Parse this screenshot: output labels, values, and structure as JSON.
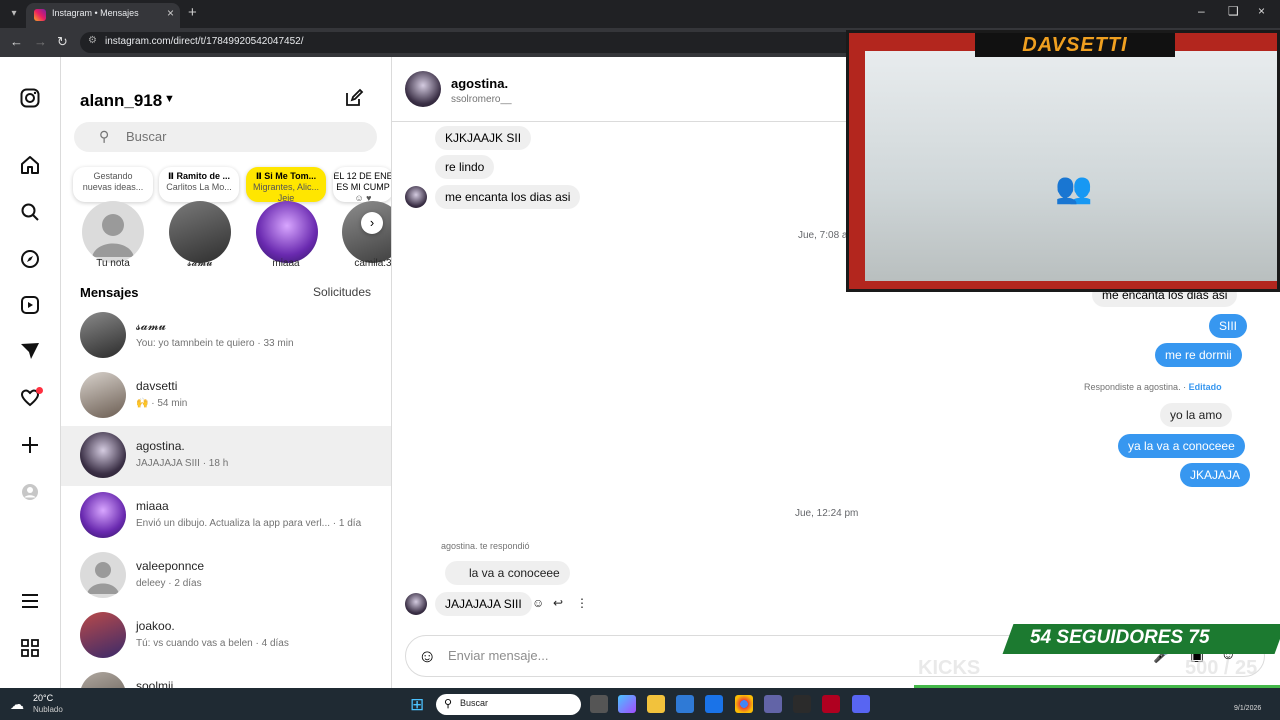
{
  "browser": {
    "tab_title": "Instagram • Mensajes",
    "url": "instagram.com/direct/t/17849920542047452/"
  },
  "rail": {
    "icons": [
      "instagram-logo-icon",
      "home-icon",
      "search-icon",
      "explore-icon",
      "reels-icon",
      "messages-icon",
      "notifications-icon",
      "create-icon",
      "profile-icon",
      "menu-icon",
      "apps-icon"
    ]
  },
  "sidebar": {
    "username": "alann_918",
    "search_placeholder": "Buscar",
    "notes": [
      {
        "line1": "Gestando",
        "line2": "nuevas ideas..."
      },
      {
        "line1": "Ⅱ Ramito de ...",
        "line2": "Carlitos La Mo..."
      },
      {
        "line1": "Ⅱ Si Me Tom...",
        "line2": "Migrantes, Alic...",
        "line3": "Jeje"
      },
      {
        "line1": "EL 12 DE ENE",
        "line2": "ES MI CUMP",
        "line3": "☺ ♥"
      }
    ],
    "stories": [
      "Tu nota",
      "𝓼𝓪𝓶𝓾",
      "miaaa",
      "camila:3"
    ],
    "section_title": "Mensajes",
    "requests": "Solicitudes",
    "conversations": [
      {
        "name": "𝓼𝓪𝓶𝓾",
        "preview": "You: yo tamnbein te quiero · 33 min"
      },
      {
        "name": "davsetti",
        "preview": "🙌 · 54 min"
      },
      {
        "name": "agostina.",
        "preview": "JAJAJAJA SIII · 18 h"
      },
      {
        "name": "miaaa",
        "preview": "Envió un dibujo. Actualiza la app para verl... · 1 día"
      },
      {
        "name": "valeeponnce",
        "preview": "deleey · 2 días"
      },
      {
        "name": "joakoo.",
        "preview": "Tú: vs cuando vas a belen · 4 días"
      },
      {
        "name": "soolmii",
        "preview": ""
      }
    ]
  },
  "chat": {
    "contact_name": "agostina.",
    "contact_handle": "ssolromero__",
    "messages_in_top": [
      "KJKJAAJK SII",
      "re lindo",
      "me encanta los dias asi"
    ],
    "timestamp1": "Jue, 7:08 a",
    "messages_out": [
      "me encanta los dias asi",
      "SIII",
      "me re dormii"
    ],
    "reply_meta": "Respondiste a agostina.",
    "reply_edited": "Editado",
    "reply_quote": "yo la amo",
    "messages_out2": [
      "ya la va a conoceee",
      "JKAJAJA"
    ],
    "timestamp2": "Jue, 12:24 pm",
    "reply_in_meta": "agostina. te respondió",
    "reply_in_quote": "la va a conoceee",
    "last_message": "JAJAJAJA SIII",
    "composer_placeholder": "Enviar mensaje..."
  },
  "overlay": {
    "streamer": "DAVSETTI",
    "followers": "54 SEGUIDORES 75",
    "kicks_label": "KICKS",
    "kicks_count": "500 / 25"
  },
  "taskbar": {
    "temperature": "20°C",
    "condition": "Nublado",
    "search_placeholder": "Buscar",
    "date": "9/1/2026"
  },
  "colors": {
    "accent": "#3797f0",
    "incoming_bubble": "#efefef",
    "notif": "#ff3040"
  }
}
